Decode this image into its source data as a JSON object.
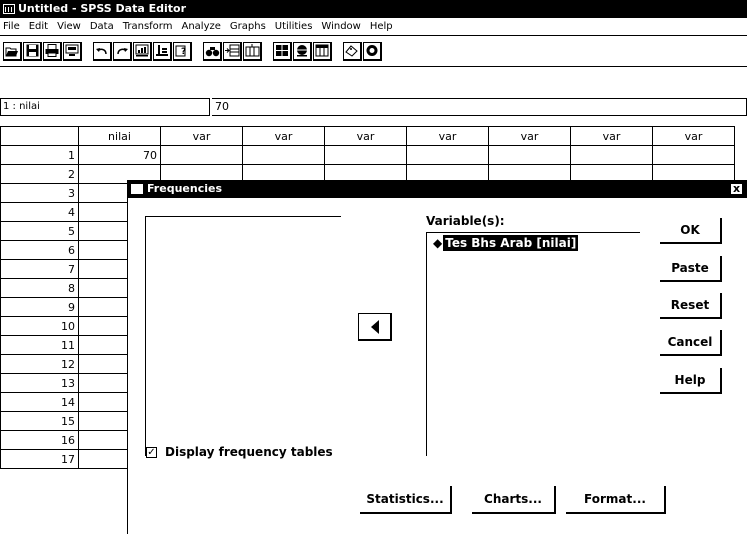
{
  "window": {
    "title": "Untitled - SPSS Data Editor"
  },
  "menu": [
    "File",
    "Edit",
    "View",
    "Data",
    "Transform",
    "Analyze",
    "Graphs",
    "Utilities",
    "Window",
    "Help"
  ],
  "toolbar": {
    "groups": [
      [
        "open-icon",
        "save-icon",
        "print-icon",
        "dialog-recall-icon"
      ],
      [
        "undo-icon",
        "redo-icon",
        "goto-chart-icon",
        "goto-case-icon",
        "variables-icon"
      ],
      [
        "find-icon",
        "insert-case-icon",
        "insert-variable-icon"
      ],
      [
        "split-file-icon",
        "weight-cases-icon",
        "select-cases-icon"
      ],
      [
        "value-labels-icon",
        "use-sets-icon"
      ]
    ]
  },
  "cell_editor": {
    "ref": "1 : nilai",
    "value": "70"
  },
  "grid": {
    "columns": [
      "nilai",
      "var",
      "var",
      "var",
      "var",
      "var",
      "var",
      "var"
    ],
    "rows": [
      "1",
      "2",
      "3",
      "4",
      "5",
      "6",
      "7",
      "8",
      "9",
      "10",
      "11",
      "12",
      "13",
      "14",
      "15",
      "16",
      "17"
    ],
    "first_row_value": "70"
  },
  "dialog": {
    "title": "Frequencies",
    "close": "x",
    "variables_label": "Variable(s):",
    "selected_variable": "Tes Bhs Arab [nilai]",
    "side_buttons": {
      "ok": "OK",
      "paste": "Paste",
      "reset": "Reset",
      "cancel": "Cancel",
      "help": "Help"
    },
    "checkbox": {
      "label": "Display frequency tables",
      "checked": true
    },
    "bottom_buttons": {
      "statistics": "Statistics...",
      "charts": "Charts...",
      "format": "Format..."
    }
  }
}
